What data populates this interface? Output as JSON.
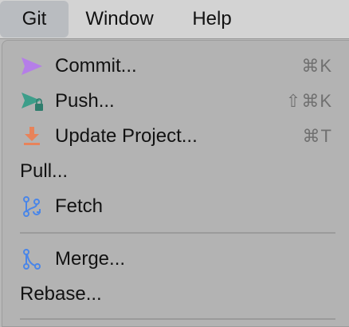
{
  "menubar": {
    "items": [
      {
        "label": "Git"
      },
      {
        "label": "Window"
      },
      {
        "label": "Help"
      }
    ]
  },
  "menu": {
    "items": [
      {
        "label": "Commit...",
        "shortcut": "⌘K",
        "icon": "commit-arrow-icon",
        "icon_color": "#b57ee8"
      },
      {
        "label": "Push...",
        "shortcut": "⇧⌘K",
        "icon": "push-arrow-icon",
        "icon_color": "#3d9e8a"
      },
      {
        "label": "Update Project...",
        "shortcut": "⌘T",
        "icon": "update-download-icon",
        "icon_color": "#e8835a"
      },
      {
        "label": "Pull..."
      },
      {
        "label": "Fetch",
        "icon": "fetch-branch-icon",
        "icon_color": "#4a86e8"
      },
      {
        "label": "Merge...",
        "icon": "merge-branch-icon",
        "icon_color": "#4a86e8"
      },
      {
        "label": "Rebase..."
      }
    ]
  }
}
